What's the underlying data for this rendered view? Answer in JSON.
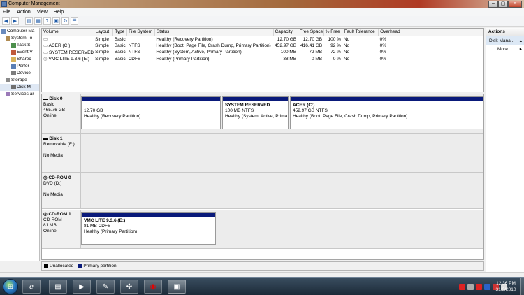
{
  "window": {
    "title": "Computer Management",
    "controls": [
      "–",
      "▢",
      "✕"
    ]
  },
  "menu": [
    "File",
    "Action",
    "View",
    "Help"
  ],
  "toolbar": {
    "icons": [
      "back-icon",
      "forward-icon",
      "folder-icon",
      "tree-icon",
      "help-icon",
      "properties-icon",
      "refresh-icon",
      "list-icon"
    ]
  },
  "tree": {
    "items": [
      {
        "label": "Computer Ma",
        "icon": "computer-icon"
      },
      {
        "label": "System To",
        "icon": "tools-icon"
      },
      {
        "label": "Task S",
        "icon": "task-icon"
      },
      {
        "label": "Event V",
        "icon": "event-icon"
      },
      {
        "label": "Sharec",
        "icon": "share-icon"
      },
      {
        "label": "Perfor",
        "icon": "perf-icon"
      },
      {
        "label": "Device",
        "icon": "device-icon"
      },
      {
        "label": "Storage",
        "icon": "storage-icon"
      },
      {
        "label": "Disk M",
        "icon": "disk-icon"
      },
      {
        "label": "Services ar",
        "icon": "services-icon"
      }
    ]
  },
  "volumes": {
    "columns": [
      "Volume",
      "Layout",
      "Type",
      "File System",
      "Status",
      "Capacity",
      "Free Space",
      "% Free",
      "Fault Tolerance",
      "Overhead"
    ],
    "rows": [
      [
        "",
        "Simple",
        "Basic",
        "",
        "Healthy (Recovery Partition)",
        "12.70 GB",
        "12.70 GB",
        "100 %",
        "No",
        "0%"
      ],
      [
        "ACER (C:)",
        "Simple",
        "Basic",
        "NTFS",
        "Healthy (Boot, Page File, Crash Dump, Primary Partition)",
        "452.97 GB",
        "416.41 GB",
        "92 %",
        "No",
        "0%"
      ],
      [
        "SYSTEM RESERVED",
        "Simple",
        "Basic",
        "NTFS",
        "Healthy (System, Active, Primary Partition)",
        "100 MB",
        "72 MB",
        "72 %",
        "No",
        "0%"
      ],
      [
        "VMC LITE 9.3.6 (E:)",
        "Simple",
        "Basic",
        "CDFS",
        "Healthy (Primary Partition)",
        "38 MB",
        "0 MB",
        "0 %",
        "No",
        "0%"
      ]
    ]
  },
  "disks": [
    {
      "name": "Disk 0",
      "lines": [
        "Basic",
        "465.76 GB",
        "Online"
      ],
      "partitions": [
        {
          "title": "",
          "size": "12.70 GB",
          "status": "Healthy (Recovery Partition)"
        },
        {
          "title": "SYSTEM RESERVED",
          "size": "100 MB NTFS",
          "status": "Healthy (System, Active, Prima"
        },
        {
          "title": "ACER (C:)",
          "size": "452.97 GB NTFS",
          "status": "Healthy (Boot, Page File, Crash Dump, Primary Partition)"
        }
      ]
    },
    {
      "name": "Disk 1",
      "lines": [
        "Removable (F:)",
        "",
        "No Media"
      ]
    },
    {
      "name": "CD-ROM 0",
      "lines": [
        "DVD (D:)",
        "",
        "No Media"
      ]
    },
    {
      "name": "CD-ROM 1",
      "lines": [
        "CD-ROM",
        "81 MB",
        "Online"
      ],
      "partitions": [
        {
          "title": "VMC LITE 9.3.6 (E:)",
          "size": "81 MB CDFS",
          "status": "Healthy (Primary Partition)"
        }
      ]
    }
  ],
  "legend": [
    {
      "label": "Unallocated",
      "color": "#000000"
    },
    {
      "label": "Primary partition",
      "color": "#0a1a7a"
    }
  ],
  "actions": {
    "header": "Actions",
    "section": "Disk Mana...",
    "more": "More ..."
  },
  "taskbar": {
    "apps": [
      "ie-icon",
      "explorer-icon",
      "media-player-icon",
      "paint-icon",
      "network-icon",
      "vodafone-icon",
      "computer-management-icon"
    ],
    "time": "12:36 PM",
    "date": "31/3/2010"
  },
  "colors": {
    "primary_partition": "#0a1a7a",
    "unallocated": "#000000",
    "actions_highlight": "#dce8f5"
  }
}
